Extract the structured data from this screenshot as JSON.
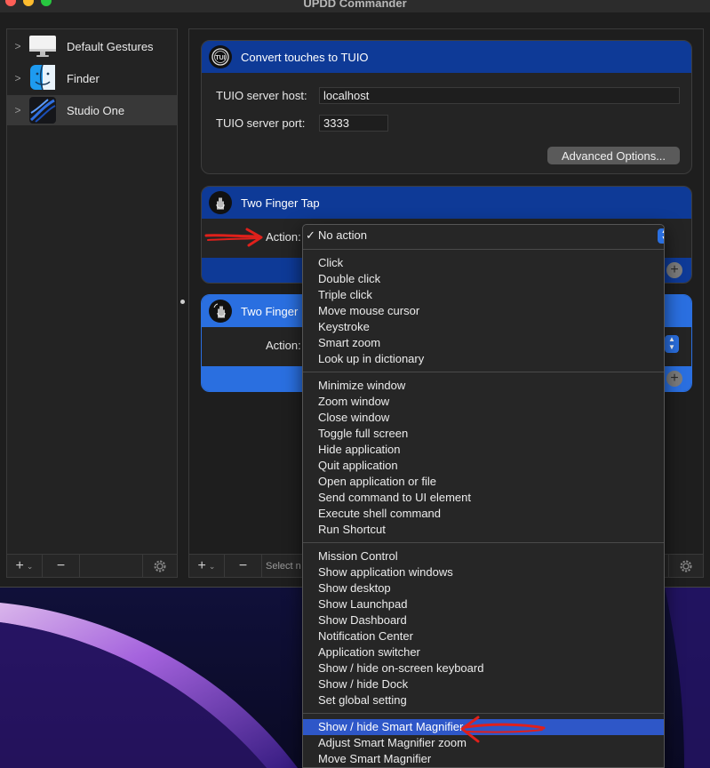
{
  "window": {
    "title": "UPDD Commander"
  },
  "sidebar": {
    "items": [
      {
        "label": "Default Gestures",
        "icon": "monitor-icon"
      },
      {
        "label": "Finder",
        "icon": "finder-icon"
      },
      {
        "label": "Studio One",
        "icon": "studio-one-icon",
        "selected": true
      }
    ],
    "add": "+",
    "remove": "−"
  },
  "tuio": {
    "title": "Convert touches to TUIO",
    "host_label": "TUIO server host:",
    "host_value": "localhost",
    "port_label": "TUIO server port:",
    "port_value": "3333",
    "advanced_button": "Advanced Options..."
  },
  "gesture1": {
    "title": "Two Finger Tap",
    "action_label": "Action:"
  },
  "gesture2": {
    "title": "Two Finger",
    "action_label": "Action:"
  },
  "main_bottombar": {
    "add": "+",
    "remove": "−",
    "select_placeholder": "Select n"
  },
  "menu": {
    "selected": "No action",
    "check": "✓",
    "groups": [
      [
        "Click",
        "Double click",
        "Triple click",
        "Move mouse cursor",
        "Keystroke",
        "Smart zoom",
        "Look up in dictionary"
      ],
      [
        "Minimize window",
        "Zoom window",
        "Close window",
        "Toggle full screen",
        "Hide application",
        "Quit application",
        "Open application or file",
        "Send command to UI element",
        "Execute shell command",
        "Run Shortcut"
      ],
      [
        "Mission Control",
        "Show application windows",
        "Show desktop",
        "Show Launchpad",
        "Show Dashboard",
        "Notification Center",
        "Application switcher",
        "Show / hide on-screen keyboard",
        "Show / hide Dock",
        "Set global setting"
      ],
      [
        "Show / hide Smart Magnifier",
        "Adjust Smart Magnifier zoom",
        "Move Smart Magnifier"
      ]
    ],
    "highlighted": "Show / hide Smart Magnifier"
  },
  "colors": {
    "header_blue": "#0e3a97",
    "active_blue": "#2a6fe0",
    "highlight": "#2e57c8",
    "annotation_red": "#e0201b"
  }
}
